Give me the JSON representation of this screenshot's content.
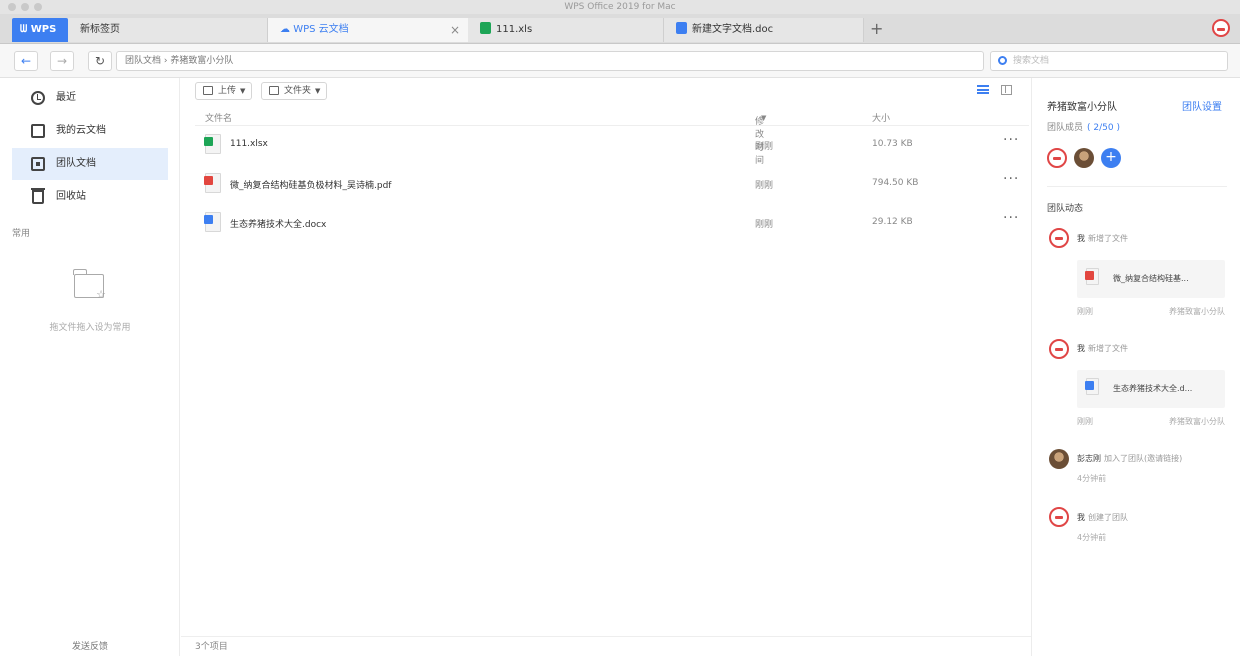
{
  "window": {
    "title": "WPS Office 2019 for Mac"
  },
  "tabs": [
    {
      "label": "WPS"
    },
    {
      "label": "新标签页"
    },
    {
      "label": "WPS 云文档",
      "close": "×"
    },
    {
      "label": "111.xls"
    },
    {
      "label": "新建文字文档.doc"
    }
  ],
  "tabbar": {
    "new_tab": "+"
  },
  "nav": {
    "back": "←",
    "forward": "→",
    "refresh": "↻",
    "breadcrumb": "团队文档 › 养猪致富小分队",
    "search_placeholder": "搜索文档"
  },
  "sidebar": {
    "items": [
      {
        "label": "最近"
      },
      {
        "label": "我的云文档"
      },
      {
        "label": "团队文档"
      },
      {
        "label": "回收站"
      }
    ],
    "section_label": "常用",
    "fav_hint": "拖文件拖入设为常用",
    "feedback": "发送反馈"
  },
  "toolbar": {
    "upload_label": "上传",
    "new_folder_label": "文件夹",
    "caret": "▼"
  },
  "table": {
    "headers": {
      "name": "文件名",
      "modified": "修改时间",
      "sort": "▼",
      "size": "大小"
    },
    "rows": [
      {
        "name": "111.xlsx",
        "modified": "刚刚",
        "size": "10.73 KB",
        "more": "···"
      },
      {
        "name": "微_纳复合结构硅基负极材料_吴诗楠.pdf",
        "modified": "刚刚",
        "size": "794.50 KB",
        "more": "···"
      },
      {
        "name": "生态养猪技术大全.docx",
        "modified": "刚刚",
        "size": "29.12 KB",
        "more": "···"
      }
    ]
  },
  "status": {
    "count": "3个项目"
  },
  "right_panel": {
    "team_name": "养猪致富小分队",
    "settings_label": "团队设置",
    "members_label": "团队成员",
    "members_count": "( 2/50 )",
    "add_member": "+",
    "activity_title": "团队动态",
    "activities": [
      {
        "user": "我",
        "action": "新增了文件",
        "file": "微_纳复合结构硅基...",
        "time": "刚刚",
        "team": "养猪致富小分队"
      },
      {
        "user": "我",
        "action": "新增了文件",
        "file": "生态养猪技术大全.d...",
        "time": "刚刚",
        "team": "养猪致富小分队"
      },
      {
        "user": "彭志刚",
        "action": "加入了团队(邀请链接)",
        "time": "4分钟前"
      },
      {
        "user": "我",
        "action": "创建了团队",
        "time": "4分钟前"
      }
    ]
  },
  "colors": {
    "accent": "#3d7ff1",
    "xls": "#1da556",
    "pdf": "#e2463f",
    "avatar_ring": "#e04646"
  }
}
